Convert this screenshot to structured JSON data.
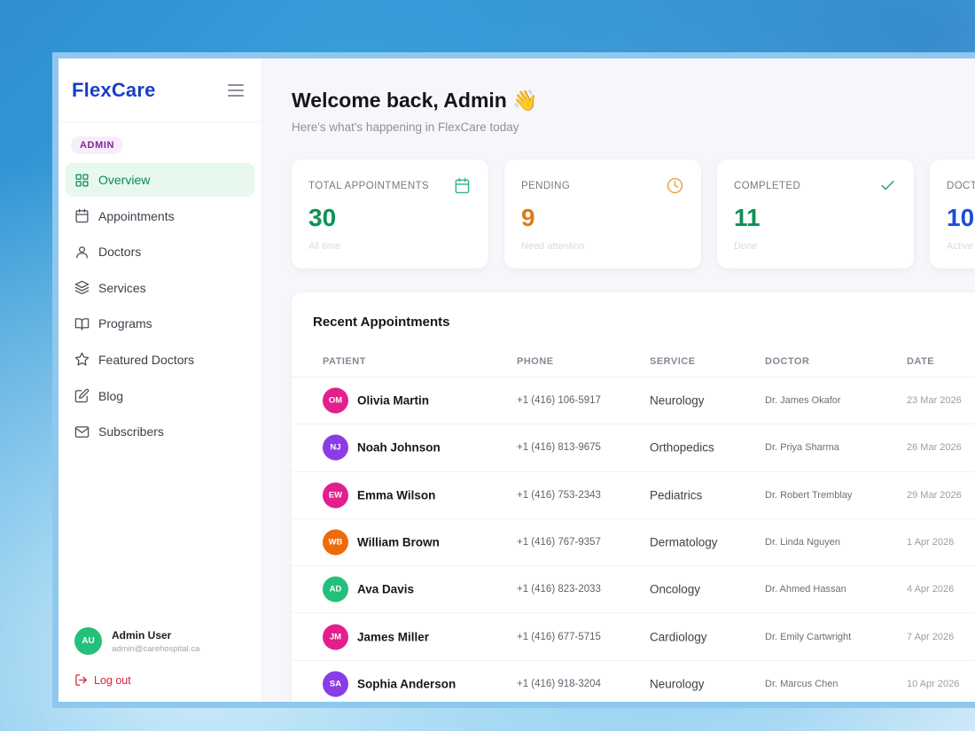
{
  "brand": {
    "name": "FlexCare"
  },
  "sidebar": {
    "role_badge": "ADMIN",
    "items": [
      {
        "label": "Overview",
        "icon": "grid-icon",
        "active": true
      },
      {
        "label": "Appointments",
        "icon": "calendar-icon"
      },
      {
        "label": "Doctors",
        "icon": "user-icon"
      },
      {
        "label": "Services",
        "icon": "layers-icon"
      },
      {
        "label": "Programs",
        "icon": "book-icon"
      },
      {
        "label": "Featured Doctors",
        "icon": "star-icon"
      },
      {
        "label": "Blog",
        "icon": "edit-icon"
      },
      {
        "label": "Subscribers",
        "icon": "mail-icon"
      }
    ],
    "user": {
      "initials": "AU",
      "name": "Admin User",
      "email": "admin@carehospital.ca",
      "avatar_color": "#22c07a"
    },
    "logout_label": "Log out"
  },
  "header": {
    "welcome": "Welcome back, Admin 👋",
    "subtitle": "Here's what's happening in FlexCare today"
  },
  "stats": [
    {
      "label": "TOTAL APPOINTMENTS",
      "value": "30",
      "sub": "All time",
      "color": "#0d9255",
      "icon": "calendar-icon",
      "icon_color": "#2fb58c"
    },
    {
      "label": "PENDING",
      "value": "9",
      "sub": "Need attention",
      "color": "#e07a12",
      "icon": "clock-icon",
      "icon_color": "#e4a23a"
    },
    {
      "label": "COMPLETED",
      "value": "11",
      "sub": "Done",
      "color": "#0d9255",
      "icon": "check-icon",
      "icon_color": "#1f9e66"
    },
    {
      "label": "DOCT",
      "value": "10",
      "sub": "Active",
      "color": "#1a4fd8",
      "icon": "",
      "icon_color": "#1a4fd8"
    }
  ],
  "appointments": {
    "title": "Recent Appointments",
    "columns": [
      "PATIENT",
      "PHONE",
      "SERVICE",
      "DOCTOR",
      "DATE"
    ],
    "rows": [
      {
        "initials": "OM",
        "color": "#e21f8c",
        "name": "Olivia Martin",
        "phone": "+1 (416) 106-5917",
        "service": "Neurology",
        "doctor": "Dr. James Okafor",
        "date": "23 Mar 2026"
      },
      {
        "initials": "NJ",
        "color": "#8a3ce6",
        "name": "Noah Johnson",
        "phone": "+1 (416) 813-9675",
        "service": "Orthopedics",
        "doctor": "Dr. Priya Sharma",
        "date": "26 Mar 2026"
      },
      {
        "initials": "EW",
        "color": "#e21f8c",
        "name": "Emma Wilson",
        "phone": "+1 (416) 753-2343",
        "service": "Pediatrics",
        "doctor": "Dr. Robert Tremblay",
        "date": "29 Mar 2026"
      },
      {
        "initials": "WB",
        "color": "#ee6a0c",
        "name": "William Brown",
        "phone": "+1 (416) 767-9357",
        "service": "Dermatology",
        "doctor": "Dr. Linda Nguyen",
        "date": "1 Apr 2026"
      },
      {
        "initials": "AD",
        "color": "#22c07a",
        "name": "Ava Davis",
        "phone": "+1 (416) 823-2033",
        "service": "Oncology",
        "doctor": "Dr. Ahmed Hassan",
        "date": "4 Apr 2026"
      },
      {
        "initials": "JM",
        "color": "#e21f8c",
        "name": "James Miller",
        "phone": "+1 (416) 677-5715",
        "service": "Cardiology",
        "doctor": "Dr. Emily Cartwright",
        "date": "7 Apr 2026"
      },
      {
        "initials": "SA",
        "color": "#8a3ce6",
        "name": "Sophia Anderson",
        "phone": "+1 (416) 918-3204",
        "service": "Neurology",
        "doctor": "Dr. Marcus Chen",
        "date": "10 Apr 2026"
      }
    ]
  }
}
